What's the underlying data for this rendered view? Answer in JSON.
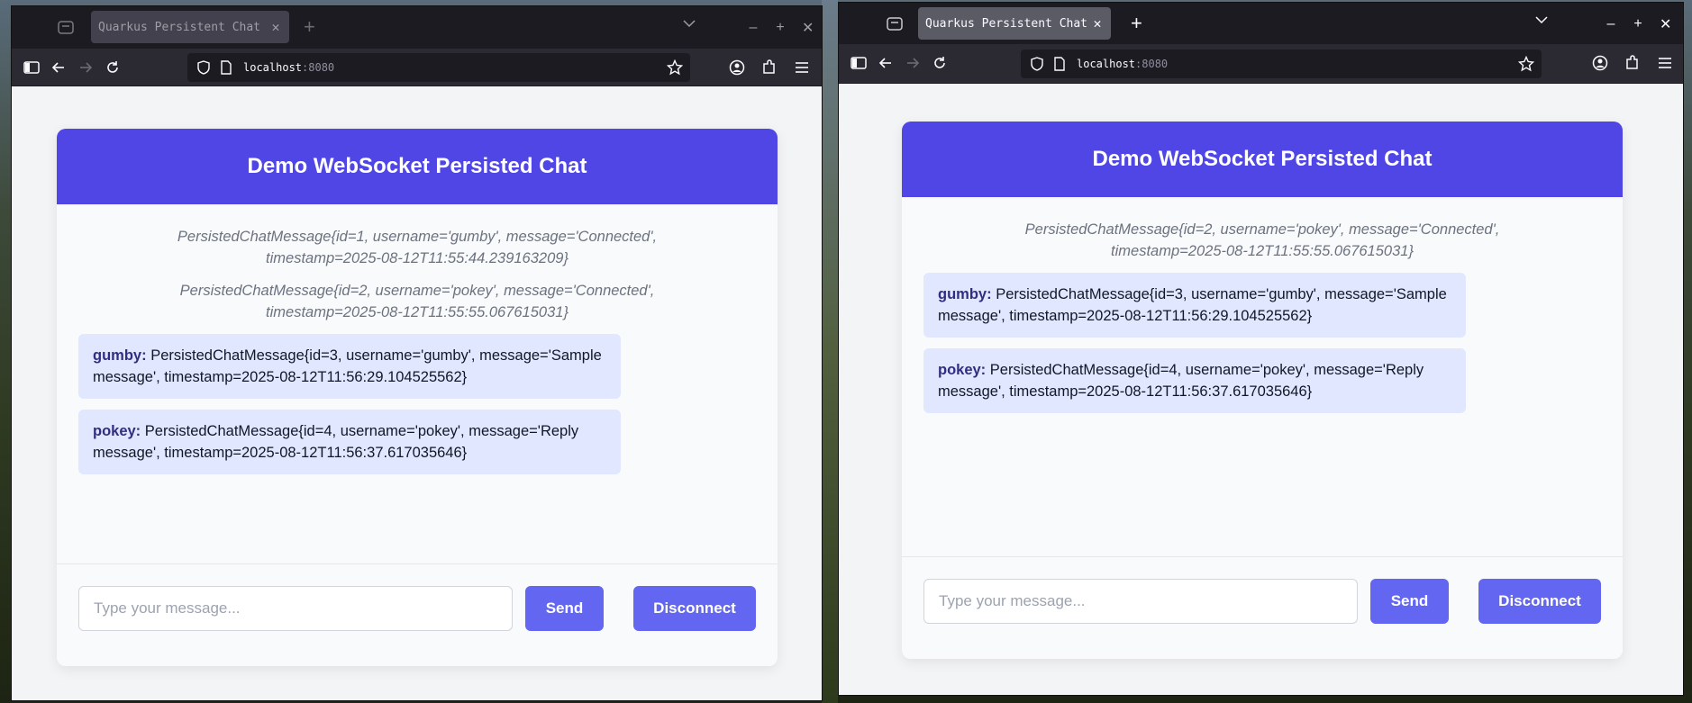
{
  "windows": [
    {
      "tab_title": "Quarkus Persistent Chat",
      "url_host": "localhost",
      "url_port": ":8080",
      "chat": {
        "title": "Demo WebSocket Persisted Chat",
        "system_messages": [
          "PersistedChatMessage{id=1, username='gumby', message='Connected', timestamp=2025-08-12T11:55:44.239163209}",
          "PersistedChatMessage{id=2, username='pokey', message='Connected', timestamp=2025-08-12T11:55:55.067615031}"
        ],
        "messages": [
          {
            "user": "gumby:",
            "text": "PersistedChatMessage{id=3, username='gumby', message='Sample message', timestamp=2025-08-12T11:56:29.104525562}"
          },
          {
            "user": "pokey:",
            "text": "PersistedChatMessage{id=4, username='pokey', message='Reply message', timestamp=2025-08-12T11:56:37.617035646}"
          }
        ],
        "input_placeholder": "Type your message...",
        "send_label": "Send",
        "disconnect_label": "Disconnect"
      }
    },
    {
      "tab_title": "Quarkus Persistent Chat",
      "url_host": "localhost",
      "url_port": ":8080",
      "chat": {
        "title": "Demo WebSocket Persisted Chat",
        "system_messages": [
          "PersistedChatMessage{id=2, username='pokey', message='Connected', timestamp=2025-08-12T11:55:55.067615031}"
        ],
        "messages": [
          {
            "user": "gumby:",
            "text": "PersistedChatMessage{id=3, username='gumby', message='Sample message', timestamp=2025-08-12T11:56:29.104525562}"
          },
          {
            "user": "pokey:",
            "text": "PersistedChatMessage{id=4, username='pokey', message='Reply message', timestamp=2025-08-12T11:56:37.617035646}"
          }
        ],
        "input_placeholder": "Type your message...",
        "send_label": "Send",
        "disconnect_label": "Disconnect"
      }
    }
  ],
  "icons": {
    "tab_bar": [
      "tab-list-icon",
      "tab-close-icon",
      "new-tab-icon",
      "list-all-tabs-icon",
      "minimize-icon",
      "maximize-icon",
      "close-window-icon"
    ],
    "nav_bar": [
      "sidebar-icon",
      "back-arrow-icon",
      "forward-arrow-icon",
      "reload-icon",
      "shield-icon",
      "page-icon",
      "bookmark-star-icon",
      "account-icon",
      "extensions-icon",
      "hamburger-menu-icon"
    ]
  },
  "colors": {
    "header": "#4f46e5",
    "button": "#6366f1",
    "user_bubble": "#e0e7ff",
    "username": "#312e81",
    "system_text": "#6b7280"
  }
}
